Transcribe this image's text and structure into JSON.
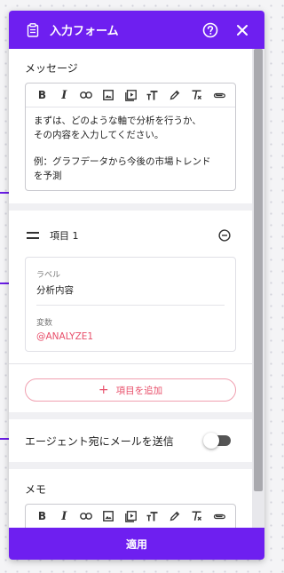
{
  "colors": {
    "accent": "#6e1ff0",
    "pink": "#e8506b"
  },
  "header": {
    "title": "入力フォーム",
    "icons": [
      "clipboard-icon",
      "help-icon",
      "close-icon"
    ]
  },
  "message": {
    "label": "メッセージ",
    "toolbar": [
      "bold",
      "italic",
      "link",
      "image",
      "video",
      "text-size",
      "pen",
      "clear-format",
      "attach"
    ],
    "lines": [
      "まずは、どのような軸で分析を行うか、",
      "その内容を入力してください。"
    ],
    "example_lines": [
      "例：グラフデータから今後の市場トレンド",
      "を予測"
    ]
  },
  "item1": {
    "title": "項目 1",
    "label_caption": "ラベル",
    "label_value": "分析内容",
    "variable_caption": "変数",
    "variable_value": "@ANALYZE1",
    "add_label": "項目を追加"
  },
  "email": {
    "label": "エージェント宛にメールを送信",
    "enabled": false
  },
  "memo": {
    "label": "メモ"
  },
  "footer": {
    "apply_label": "適用"
  }
}
